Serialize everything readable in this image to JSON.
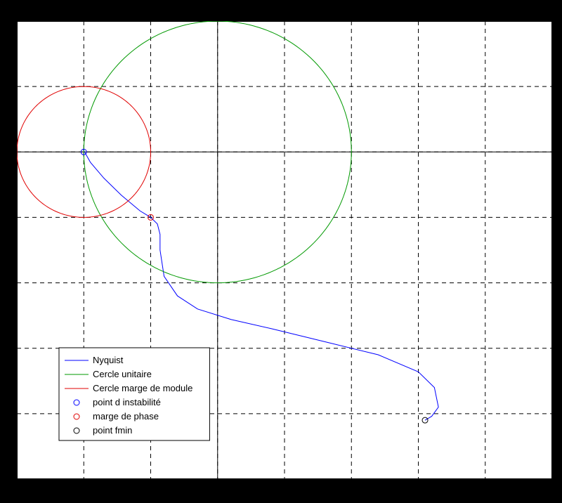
{
  "chart_data": {
    "type": "line",
    "title": "",
    "xlabel": "",
    "ylabel": "",
    "xlim": [
      -1.5,
      2.5
    ],
    "ylim": [
      -2.5,
      1.0
    ],
    "xticks": [
      -1.5,
      -1.0,
      -0.5,
      0,
      0.5,
      1.0,
      1.5,
      2.0,
      2.5
    ],
    "yticks": [
      -2.5,
      -2.0,
      -1.5,
      -1.0,
      -0.5,
      0,
      0.5,
      1.0
    ],
    "series": [
      {
        "name": "Nyquist",
        "color": "#0000ff",
        "type": "line",
        "points": [
          [
            -1.005,
            0.02
          ],
          [
            -0.95,
            -0.08
          ],
          [
            -0.85,
            -0.2
          ],
          [
            -0.72,
            -0.33
          ],
          [
            -0.58,
            -0.45
          ],
          [
            -0.5,
            -0.5
          ],
          [
            -0.45,
            -0.55
          ],
          [
            -0.43,
            -0.63
          ],
          [
            -0.43,
            -0.75
          ],
          [
            -0.4,
            -0.95
          ],
          [
            -0.3,
            -1.1
          ],
          [
            -0.15,
            -1.2
          ],
          [
            0.1,
            -1.28
          ],
          [
            0.4,
            -1.35
          ],
          [
            0.8,
            -1.45
          ],
          [
            1.2,
            -1.55
          ],
          [
            1.5,
            -1.68
          ],
          [
            1.62,
            -1.8
          ],
          [
            1.65,
            -1.95
          ],
          [
            1.6,
            -2.02
          ],
          [
            1.55,
            -2.05
          ]
        ]
      },
      {
        "name": "Cercle unitaire",
        "color": "#009900",
        "type": "circle",
        "center": [
          0,
          0
        ],
        "radius": 1.0
      },
      {
        "name": "Cercle marge de module",
        "color": "#e00000",
        "type": "circle",
        "center": [
          -1,
          0
        ],
        "radius": 0.5
      }
    ],
    "markers": [
      {
        "name": "point d instabilité",
        "color": "#0000ff",
        "x": -1.0,
        "y": 0.0
      },
      {
        "name": "marge de phase",
        "color": "#e00000",
        "x": -0.5,
        "y": -0.5
      },
      {
        "name": "point fmin",
        "color": "#000000",
        "x": 1.55,
        "y": -2.05
      }
    ],
    "legend": {
      "position": "lower-left",
      "items": [
        {
          "label": "Nyquist",
          "color": "#0000ff",
          "style": "line"
        },
        {
          "label": "Cercle unitaire",
          "color": "#009900",
          "style": "line"
        },
        {
          "label": "Cercle marge de module",
          "color": "#e00000",
          "style": "line"
        },
        {
          "label": "point d instabilité",
          "color": "#0000ff",
          "style": "marker"
        },
        {
          "label": "marge de phase",
          "color": "#e00000",
          "style": "marker"
        },
        {
          "label": "point fmin",
          "color": "#000000",
          "style": "marker"
        }
      ]
    }
  }
}
